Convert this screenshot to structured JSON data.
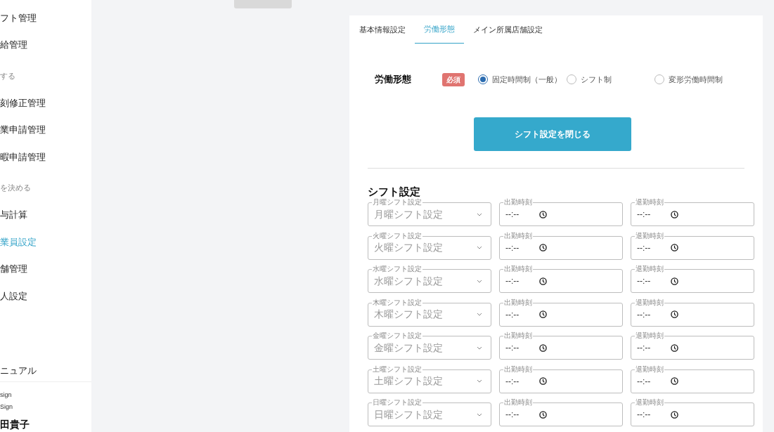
{
  "sidebar": {
    "items": [
      {
        "kind": "item",
        "label": "フト管理",
        "selected": false
      },
      {
        "kind": "item",
        "label": "給管理",
        "selected": false
      },
      {
        "kind": "header",
        "label": "する"
      },
      {
        "kind": "item",
        "label": "刻修正管理",
        "selected": false
      },
      {
        "kind": "item",
        "label": "業申請管理",
        "selected": false
      },
      {
        "kind": "item",
        "label": "暇申請管理",
        "selected": false
      },
      {
        "kind": "header",
        "label": "を決める"
      },
      {
        "kind": "item",
        "label": "与計算",
        "selected": false
      },
      {
        "kind": "item",
        "label": "業員設定",
        "selected": true
      },
      {
        "kind": "item",
        "label": "舗管理",
        "selected": false
      },
      {
        "kind": "item",
        "label": "人設定",
        "selected": false
      }
    ],
    "manual": "ニュアル",
    "user": {
      "lines": [
        "sign",
        "Sign"
      ],
      "name": "田貴子"
    }
  },
  "tabs": [
    {
      "label": "基本情報設定",
      "selected": false
    },
    {
      "label": "労働形態",
      "selected": true
    },
    {
      "label": "メイン所属店舗設定",
      "selected": false
    }
  ],
  "work_type": {
    "label": "労働形態",
    "badge": "必須",
    "options": [
      {
        "label": "固定時間制（一般）",
        "selected": true
      },
      {
        "label": "シフト制",
        "selected": false
      },
      {
        "label": "変形労働時間制",
        "selected": false
      }
    ]
  },
  "close_button": "シフト設定を閉じる",
  "shift_settings": {
    "title": "シフト設定",
    "rows": [
      {
        "day_label": "月曜シフト設定",
        "placeholder": "月曜シフト設定",
        "start_label": "出勤時刻",
        "start_value": "--:--",
        "end_label": "退勤時刻",
        "end_value": "--:--"
      },
      {
        "day_label": "火曜シフト設定",
        "placeholder": "火曜シフト設定",
        "start_label": "出勤時刻",
        "start_value": "--:--",
        "end_label": "退勤時刻",
        "end_value": "--:--"
      },
      {
        "day_label": "水曜シフト設定",
        "placeholder": "水曜シフト設定",
        "start_label": "出勤時刻",
        "start_value": "--:--",
        "end_label": "退勤時刻",
        "end_value": "--:--"
      },
      {
        "day_label": "木曜シフト設定",
        "placeholder": "木曜シフト設定",
        "start_label": "出勤時刻",
        "start_value": "--:--",
        "end_label": "退勤時刻",
        "end_value": "--:--"
      },
      {
        "day_label": "金曜シフト設定",
        "placeholder": "金曜シフト設定",
        "start_label": "出勤時刻",
        "start_value": "--:--",
        "end_label": "退勤時刻",
        "end_value": "--:--"
      },
      {
        "day_label": "土曜シフト設定",
        "placeholder": "土曜シフト設定",
        "start_label": "出勤時刻",
        "start_value": "--:--",
        "end_label": "退勤時刻",
        "end_value": "--:--"
      },
      {
        "day_label": "日曜シフト設定",
        "placeholder": "日曜シフト設定",
        "start_label": "出勤時刻",
        "start_value": "--:--",
        "end_label": "退勤時刻",
        "end_value": "--:--"
      }
    ]
  }
}
